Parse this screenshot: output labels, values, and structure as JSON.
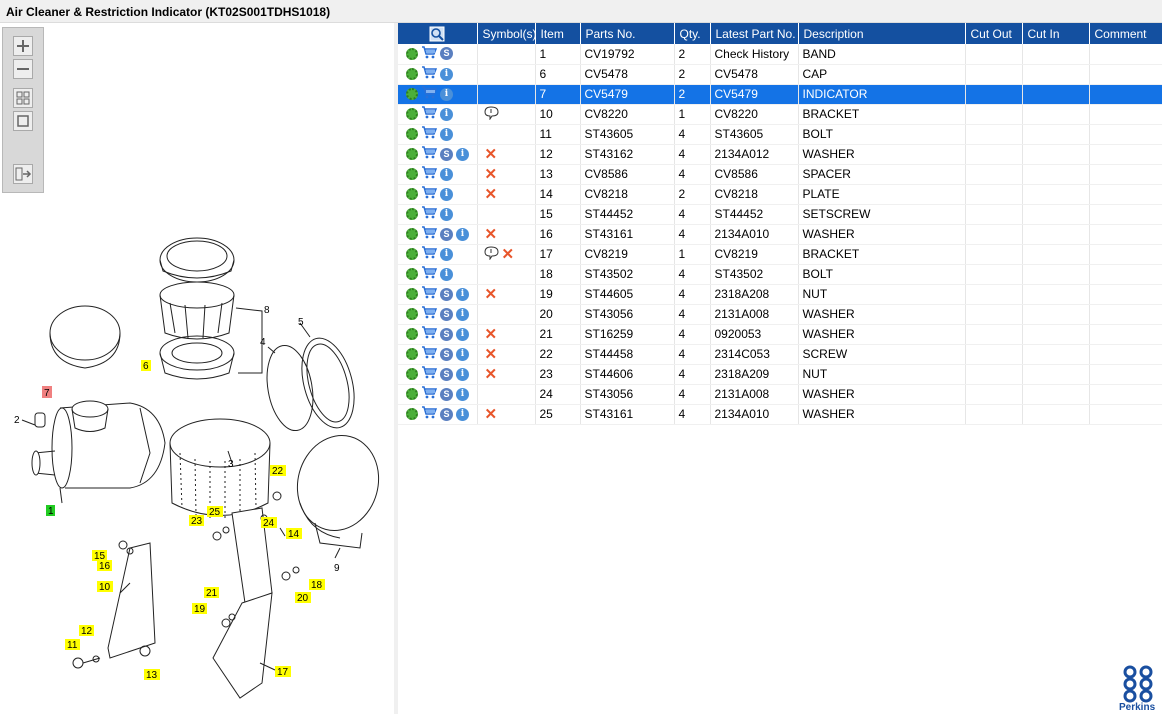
{
  "window": {
    "title": "Air Cleaner & Restriction Indicator (KT02S001TDHS1018)"
  },
  "toolbar": {
    "zoom_in": "zoom-in-icon",
    "zoom_out": "zoom-out-icon",
    "fit_all": "fit-all-icon",
    "fit_window": "fit-window-icon",
    "export": "export-list-icon"
  },
  "diagram": {
    "callouts": [
      {
        "label": "1",
        "color": "#22cc22"
      },
      {
        "label": "2",
        "color": "none"
      },
      {
        "label": "3",
        "color": "none"
      },
      {
        "label": "4",
        "color": "none"
      },
      {
        "label": "5",
        "color": "none"
      },
      {
        "label": "6",
        "color": "#ffff00"
      },
      {
        "label": "7",
        "color": "#f08080"
      },
      {
        "label": "8",
        "color": "none"
      },
      {
        "label": "9",
        "color": "none"
      },
      {
        "label": "10",
        "color": "#ffff00"
      },
      {
        "label": "11",
        "color": "#ffff00"
      },
      {
        "label": "12",
        "color": "#ffff00"
      },
      {
        "label": "13",
        "color": "#ffff00"
      },
      {
        "label": "14",
        "color": "#ffff00"
      },
      {
        "label": "15",
        "color": "#ffff00"
      },
      {
        "label": "16",
        "color": "#ffff00"
      },
      {
        "label": "17",
        "color": "#ffff00"
      },
      {
        "label": "18",
        "color": "#ffff00"
      },
      {
        "label": "19",
        "color": "#ffff00"
      },
      {
        "label": "20",
        "color": "#ffff00"
      },
      {
        "label": "21",
        "color": "#ffff00"
      },
      {
        "label": "22",
        "color": "#ffff00"
      },
      {
        "label": "23",
        "color": "#ffff00"
      },
      {
        "label": "24",
        "color": "#ffff00"
      },
      {
        "label": "25",
        "color": "#ffff00"
      }
    ]
  },
  "grid": {
    "columns": [
      "",
      "Symbol(s)",
      "Item",
      "Parts No.",
      "Qty.",
      "Latest Part No.",
      "Description",
      "Cut Out",
      "Cut In",
      "Comment"
    ],
    "selected_row": 2,
    "rows": [
      {
        "gear": "multi",
        "s": true,
        "i": false,
        "sym": [],
        "item": "1",
        "part": "CV19792",
        "qty": "2",
        "latest": "Check History",
        "desc": "BAND"
      },
      {
        "gear": "single",
        "s": false,
        "i": true,
        "sym": [],
        "item": "6",
        "part": "CV5478",
        "qty": "2",
        "latest": "CV5478",
        "desc": "CAP"
      },
      {
        "gear": "single",
        "s": false,
        "i": true,
        "sym": [],
        "item": "7",
        "part": "CV5479",
        "qty": "2",
        "latest": "CV5479",
        "desc": "INDICATOR"
      },
      {
        "gear": "single",
        "s": false,
        "i": true,
        "sym": [
          "note"
        ],
        "item": "10",
        "part": "CV8220",
        "qty": "1",
        "latest": "CV8220",
        "desc": "BRACKET"
      },
      {
        "gear": "single",
        "s": false,
        "i": true,
        "sym": [],
        "item": "11",
        "part": "ST43605",
        "qty": "4",
        "latest": "ST43605",
        "desc": "BOLT"
      },
      {
        "gear": "single",
        "s": true,
        "i": true,
        "sym": [
          "x"
        ],
        "item": "12",
        "part": "ST43162",
        "qty": "4",
        "latest": "2134A012",
        "desc": "WASHER"
      },
      {
        "gear": "single",
        "s": false,
        "i": true,
        "sym": [
          "x"
        ],
        "item": "13",
        "part": "CV8586",
        "qty": "4",
        "latest": "CV8586",
        "desc": "SPACER"
      },
      {
        "gear": "single",
        "s": false,
        "i": true,
        "sym": [
          "x"
        ],
        "item": "14",
        "part": "CV8218",
        "qty": "2",
        "latest": "CV8218",
        "desc": "PLATE"
      },
      {
        "gear": "single",
        "s": false,
        "i": true,
        "sym": [],
        "item": "15",
        "part": "ST44452",
        "qty": "4",
        "latest": "ST44452",
        "desc": "SETSCREW"
      },
      {
        "gear": "single",
        "s": true,
        "i": true,
        "sym": [
          "x"
        ],
        "item": "16",
        "part": "ST43161",
        "qty": "4",
        "latest": "2134A010",
        "desc": "WASHER"
      },
      {
        "gear": "single",
        "s": false,
        "i": true,
        "sym": [
          "note",
          "x"
        ],
        "item": "17",
        "part": "CV8219",
        "qty": "1",
        "latest": "CV8219",
        "desc": "BRACKET"
      },
      {
        "gear": "single",
        "s": false,
        "i": true,
        "sym": [],
        "item": "18",
        "part": "ST43502",
        "qty": "4",
        "latest": "ST43502",
        "desc": "BOLT"
      },
      {
        "gear": "single",
        "s": true,
        "i": true,
        "sym": [
          "x"
        ],
        "item": "19",
        "part": "ST44605",
        "qty": "4",
        "latest": "2318A208",
        "desc": "NUT"
      },
      {
        "gear": "single",
        "s": true,
        "i": true,
        "sym": [],
        "item": "20",
        "part": "ST43056",
        "qty": "4",
        "latest": "2131A008",
        "desc": "WASHER"
      },
      {
        "gear": "single",
        "s": true,
        "i": true,
        "sym": [
          "x"
        ],
        "item": "21",
        "part": "ST16259",
        "qty": "4",
        "latest": "0920053",
        "desc": "WASHER"
      },
      {
        "gear": "single",
        "s": true,
        "i": true,
        "sym": [
          "x"
        ],
        "item": "22",
        "part": "ST44458",
        "qty": "4",
        "latest": "2314C053",
        "desc": "SCREW"
      },
      {
        "gear": "single",
        "s": true,
        "i": true,
        "sym": [
          "x"
        ],
        "item": "23",
        "part": "ST44606",
        "qty": "4",
        "latest": "2318A209",
        "desc": "NUT"
      },
      {
        "gear": "single",
        "s": true,
        "i": true,
        "sym": [],
        "item": "24",
        "part": "ST43056",
        "qty": "4",
        "latest": "2131A008",
        "desc": "WASHER"
      },
      {
        "gear": "single",
        "s": true,
        "i": true,
        "sym": [
          "x"
        ],
        "item": "25",
        "part": "ST43161",
        "qty": "4",
        "latest": "2134A010",
        "desc": "WASHER"
      }
    ]
  },
  "brand": {
    "name": "Perkins"
  }
}
